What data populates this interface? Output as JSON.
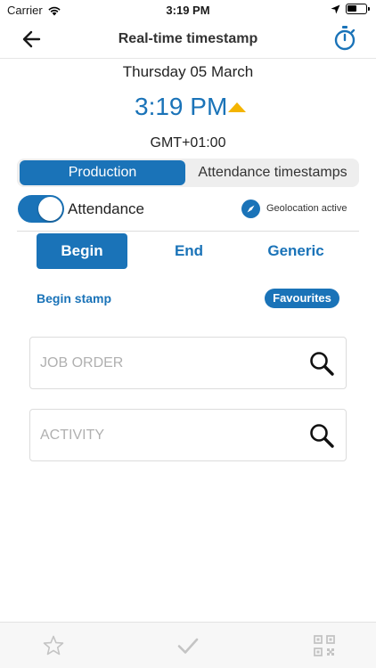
{
  "status_bar": {
    "carrier": "Carrier",
    "time": "3:19 PM"
  },
  "nav": {
    "title": "Real-time timestamp",
    "back_icon": "arrow-left-icon",
    "right_icon": "stopwatch-icon"
  },
  "clock": {
    "date": "Thursday 05 March",
    "time": "3:19 PM",
    "timezone": "GMT+01:00",
    "trend_icon": "triangle-up-icon"
  },
  "segment": {
    "options": [
      "Production",
      "Attendance timestamps"
    ],
    "selected": "Production"
  },
  "attendance_toggle": {
    "label": "Attendance",
    "on": true
  },
  "geolocation": {
    "label": "Geolocation active",
    "icon": "compass-icon"
  },
  "stamp_types": {
    "options": [
      "Begin",
      "End",
      "Generic"
    ],
    "selected": "Begin"
  },
  "stamp": {
    "label": "Begin stamp",
    "favourites_label": "Favourites"
  },
  "fields": {
    "job_order": {
      "placeholder": "JOB ORDER",
      "value": ""
    },
    "activity": {
      "placeholder": "ACTIVITY",
      "value": ""
    }
  },
  "tab_bar": {
    "icons": [
      "star-icon",
      "checkmark-icon",
      "qr-code-icon"
    ]
  },
  "colors": {
    "accent": "#1a73b8",
    "arrow": "#f4b400"
  }
}
